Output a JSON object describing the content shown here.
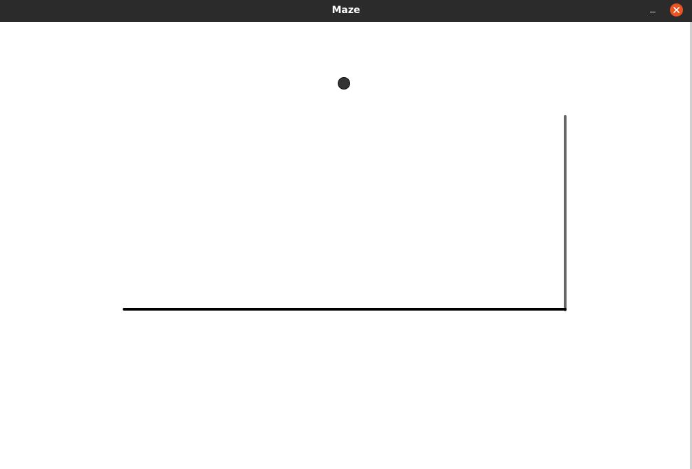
{
  "window": {
    "title": "Maze",
    "controls": {
      "minimize_icon": "minimize-icon",
      "close_icon": "close-icon",
      "close_color": "#e95420"
    }
  },
  "game": {
    "ball_color": "#333333",
    "wall_colors": {
      "floor": "#000000",
      "right_wall": "#666666"
    }
  }
}
